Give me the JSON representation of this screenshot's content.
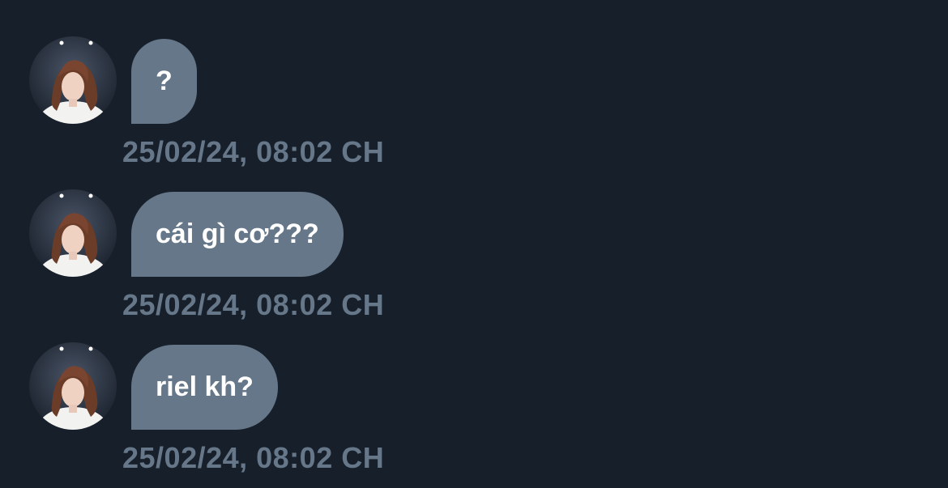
{
  "colors": {
    "background": "#17202a",
    "bubble": "#66778a",
    "bubble_text": "#ffffff",
    "timestamp": "#67778a"
  },
  "messages": [
    {
      "text": "?",
      "timestamp": "25/02/24, 08:02 CH",
      "avatar": "user-avatar"
    },
    {
      "text": "cái gì cơ???",
      "timestamp": "25/02/24, 08:02 CH",
      "avatar": "user-avatar"
    },
    {
      "text": "riel kh?",
      "timestamp": "25/02/24, 08:02 CH",
      "avatar": "user-avatar"
    }
  ]
}
